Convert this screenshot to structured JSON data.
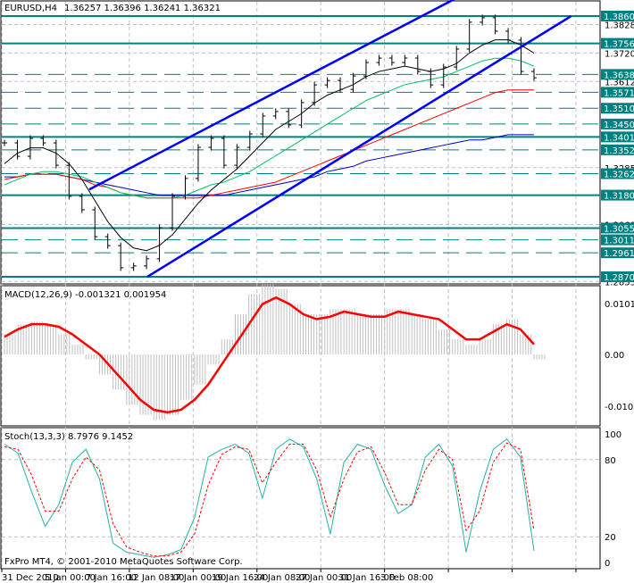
{
  "header": {
    "symbol": "EURUSD,H4",
    "ohlc": "1.36257 1.36396 1.36241 1.36321"
  },
  "copyright": "FxPro MT4, © 2001-2010 MetaQuotes Software Corp.",
  "colors": {
    "level": "#008080",
    "channel": "#0000ff",
    "ma_black": "#000000",
    "ma_red": "#ff0000",
    "ma_green": "#00c060",
    "ma_blue": "#0000c0",
    "macd_hist": "#c0c0c0",
    "macd_signal": "#ff0000",
    "stoch_main": "#20b2aa",
    "stoch_signal": "#ff0000"
  },
  "time_labels": [
    "31 Dec 2010",
    "5 Jan 00:00",
    "7 Jan 16:00",
    "12 Jan 08:00",
    "17 Jan 00:00",
    "19 Jan 16:00",
    "24 Jan 08:00",
    "27 Jan 00:00",
    "31 Jan 16:00",
    "3 Feb 08:00"
  ],
  "chart_data": [
    {
      "type": "line",
      "title": "EURUSD,H4",
      "ylim": [
        1.2855,
        1.3915
      ],
      "levels_solid": [
        1.38603,
        1.37567,
        1.34016,
        1.31806,
        1.30556,
        1.28709
      ],
      "levels_dashed": [
        1.36388,
        1.3571,
        1.35105,
        1.34507,
        1.33526,
        1.32621,
        1.3011,
        1.29618
      ],
      "level_labels": [
        "1.38603",
        "1.37567",
        "1.36388",
        "1.35710",
        "1.35105",
        "1.34507",
        "1.34016",
        "1.33526",
        "1.32621",
        "1.31806",
        "1.30556",
        "1.30110",
        "1.29618",
        "1.28709"
      ],
      "axis_ticks": [
        "1.38280",
        "1.37200",
        "1.36120",
        "1.32850",
        "1.30690",
        "1.28530"
      ],
      "axis_tick_values": [
        1.3828,
        1.372,
        1.3612,
        1.3285,
        1.3069,
        1.2853
      ],
      "close": [
        1.3379,
        1.3328,
        1.3396,
        1.3379,
        1.3294,
        1.3176,
        1.3125,
        1.3023,
        1.2989,
        1.2905,
        1.2912,
        1.2939,
        1.3057,
        1.3176,
        1.3244,
        1.3362,
        1.3396,
        1.3294,
        1.3362,
        1.3413,
        1.3481,
        1.3498,
        1.3447,
        1.3532,
        1.3599,
        1.3616,
        1.3582,
        1.3633,
        1.3684,
        1.3701,
        1.3684,
        1.3701,
        1.365,
        1.3599,
        1.3667,
        1.3735,
        1.3837,
        1.3854,
        1.3803,
        1.3769,
        1.365,
        1.3626
      ],
      "ma_black": [
        1.33,
        1.334,
        1.336,
        1.336,
        1.334,
        1.33,
        1.324,
        1.316,
        1.308,
        1.302,
        1.298,
        1.297,
        1.299,
        1.303,
        1.309,
        1.315,
        1.32,
        1.324,
        1.328,
        1.333,
        1.338,
        1.343,
        1.346,
        1.349,
        1.353,
        1.356,
        1.358,
        1.36,
        1.363,
        1.365,
        1.366,
        1.367,
        1.366,
        1.365,
        1.366,
        1.368,
        1.372,
        1.375,
        1.377,
        1.377,
        1.375,
        1.372
      ],
      "ma_green": [
        1.322,
        1.324,
        1.326,
        1.327,
        1.327,
        1.326,
        1.325,
        1.323,
        1.321,
        1.319,
        1.318,
        1.317,
        1.317,
        1.317,
        1.318,
        1.32,
        1.322,
        1.323,
        1.325,
        1.327,
        1.33,
        1.333,
        1.336,
        1.339,
        1.342,
        1.345,
        1.348,
        1.351,
        1.354,
        1.356,
        1.358,
        1.36,
        1.361,
        1.362,
        1.363,
        1.365,
        1.367,
        1.369,
        1.37,
        1.37,
        1.369,
        1.367
      ],
      "ma_red": [
        1.324,
        1.325,
        1.326,
        1.326,
        1.326,
        1.325,
        1.324,
        1.322,
        1.321,
        1.319,
        1.318,
        1.317,
        1.317,
        1.317,
        1.317,
        1.317,
        1.318,
        1.319,
        1.32,
        1.321,
        1.322,
        1.323,
        1.325,
        1.327,
        1.329,
        1.331,
        1.333,
        1.335,
        1.337,
        1.339,
        1.341,
        1.343,
        1.345,
        1.347,
        1.349,
        1.351,
        1.353,
        1.355,
        1.357,
        1.358,
        1.358,
        1.358
      ],
      "ma_blue": [
        1.325,
        1.325,
        1.326,
        1.326,
        1.326,
        1.325,
        1.324,
        1.323,
        1.322,
        1.321,
        1.32,
        1.319,
        1.318,
        1.318,
        1.318,
        1.318,
        1.318,
        1.318,
        1.319,
        1.32,
        1.321,
        1.322,
        1.323,
        1.324,
        1.325,
        1.327,
        1.328,
        1.329,
        1.331,
        1.332,
        1.333,
        1.334,
        1.335,
        1.336,
        1.337,
        1.338,
        1.339,
        1.339,
        1.34,
        1.341,
        1.341,
        1.341
      ],
      "channel_upper": [
        [
          0.16,
          1.3202
        ],
        [
          0.85,
          1.3925
        ]
      ],
      "channel_lower": [
        [
          0.27,
          1.2871
        ],
        [
          1.07,
          1.386
        ]
      ]
    },
    {
      "type": "bar",
      "title": "MACD(12,26,9) -0.001321 0.001954",
      "label": "MACD(12,26,9)",
      "values_text": "-0.001321 0.001954",
      "ylim": [
        -0.0123,
        0.0135
      ],
      "axis_ticks": [
        "0.010105",
        "0.00",
        "-0.010277"
      ],
      "axis_tick_values": [
        0.010105,
        0,
        -0.010277
      ],
      "histogram": [
        0.004,
        0.006,
        0.0065,
        0.006,
        0.004,
        0.002,
        -0.001,
        -0.004,
        -0.007,
        -0.01,
        -0.012,
        -0.013,
        -0.012,
        -0.009,
        -0.006,
        -0.002,
        0.003,
        0.008,
        0.012,
        0.014,
        0.013,
        0.01,
        0.008,
        0.008,
        0.009,
        0.009,
        0.008,
        0.008,
        0.009,
        0.009,
        0.008,
        0.007,
        0.005,
        0.003,
        0.002,
        0.003,
        0.006,
        0.007,
        0.004,
        -0.001
      ],
      "signal": [
        0.0035,
        0.005,
        0.006,
        0.006,
        0.0055,
        0.004,
        0.002,
        0.0,
        -0.003,
        -0.006,
        -0.009,
        -0.011,
        -0.0115,
        -0.011,
        -0.009,
        -0.006,
        -0.002,
        0.002,
        0.006,
        0.01,
        0.0113,
        0.01,
        0.008,
        0.007,
        0.0075,
        0.0085,
        0.008,
        0.0075,
        0.0075,
        0.0085,
        0.008,
        0.0075,
        0.007,
        0.005,
        0.003,
        0.003,
        0.0045,
        0.006,
        0.005,
        0.002
      ]
    },
    {
      "type": "line",
      "title": "Stoch(13,3,3) 8.7976 9.1452",
      "label": "Stoch(13,3,3)",
      "values_text": "8.7976 9.1452",
      "ylim": [
        -5,
        105
      ],
      "axis_ticks": [
        "100",
        "80",
        "20",
        "0"
      ],
      "axis_tick_values": [
        100,
        80,
        20,
        0
      ],
      "main": [
        92,
        85,
        55,
        28,
        45,
        78,
        88,
        65,
        15,
        8,
        6,
        4,
        6,
        10,
        35,
        82,
        88,
        92,
        85,
        50,
        88,
        96,
        90,
        65,
        22,
        78,
        92,
        88,
        60,
        38,
        45,
        82,
        92,
        75,
        8,
        55,
        88,
        96,
        82,
        9
      ],
      "signal": [
        90,
        88,
        68,
        40,
        40,
        65,
        82,
        72,
        30,
        12,
        8,
        5,
        5,
        8,
        22,
        60,
        84,
        90,
        88,
        62,
        78,
        92,
        92,
        72,
        35,
        65,
        86,
        90,
        70,
        45,
        45,
        72,
        88,
        80,
        25,
        40,
        78,
        93,
        88,
        25
      ]
    }
  ]
}
